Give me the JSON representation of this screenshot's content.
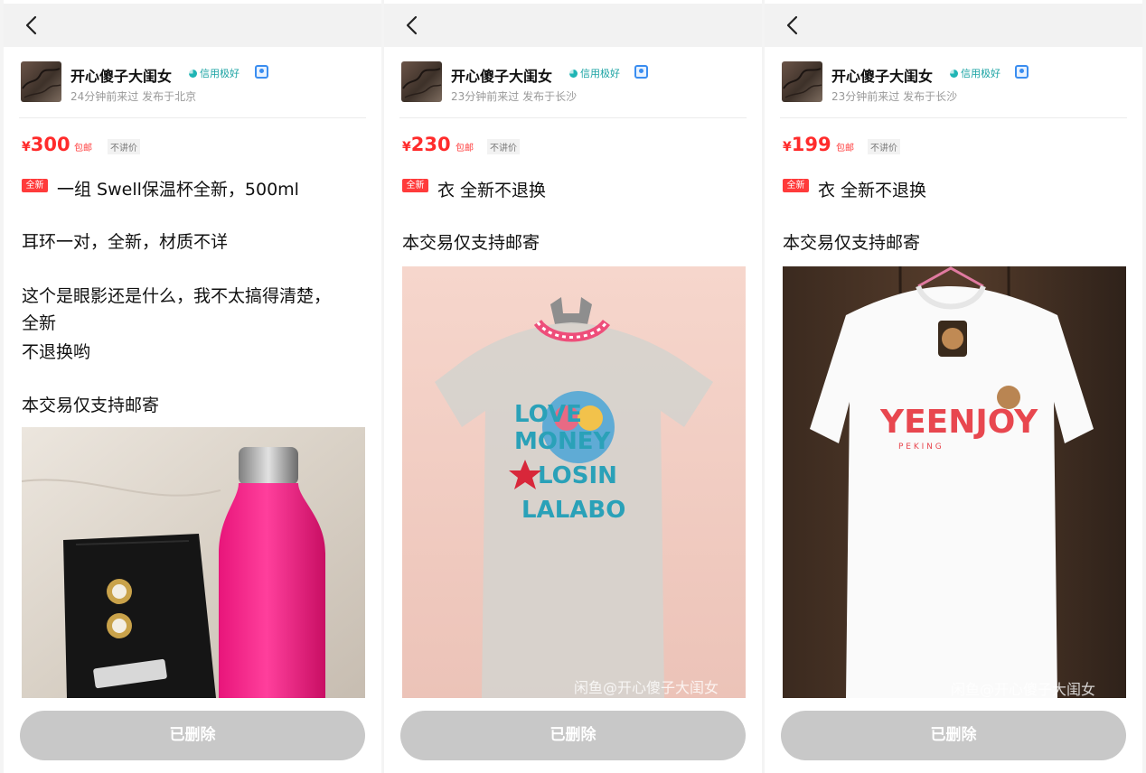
{
  "panels": [
    {
      "back_icon": "chevron-left-icon",
      "username": "开心傻子大闺女",
      "credit": "信用极好",
      "meta": "24分钟前来过 发布于北京",
      "price_symbol": "¥",
      "price": "300",
      "shipping": "包邮",
      "bargain": "不讲价",
      "new_tag": "全新",
      "title": "一组 Swell保温杯全新，500ml",
      "lines": [
        "耳环一对，全新，材质不详",
        "这个是眼影还是什么，我不太搞得清楚，",
        "全新",
        "不退换哟",
        "本交易仅支持邮寄"
      ],
      "button": "已删除"
    },
    {
      "back_icon": "chevron-left-icon",
      "username": "开心傻子大闺女",
      "credit": "信用极好",
      "meta": "23分钟前来过 发布于长沙",
      "price_symbol": "¥",
      "price": "230",
      "shipping": "包邮",
      "bargain": "不讲价",
      "new_tag": "全新",
      "title": "衣 全新不退换",
      "lines": [
        "本交易仅支持邮寄"
      ],
      "shirt_text": [
        "LOVE",
        "MONEY",
        "LOSIN",
        "LALABO"
      ],
      "watermark": "闲鱼@开心傻子大闺女",
      "button": "已删除"
    },
    {
      "back_icon": "chevron-left-icon",
      "username": "开心傻子大闺女",
      "credit": "信用极好",
      "meta": "23分钟前来过 发布于长沙",
      "price_symbol": "¥",
      "price": "199",
      "shipping": "包邮",
      "bargain": "不讲价",
      "new_tag": "全新",
      "title": "衣 全新不退换",
      "lines": [
        "本交易仅支持邮寄"
      ],
      "shirt_text": [
        "YEENJOY",
        "P E K I N G"
      ],
      "watermark": "闲鱼@开心傻子大闺女",
      "button": "已删除"
    }
  ],
  "colors": {
    "price": "#ff2b2b",
    "credit": "#1aa3a3",
    "deleted_button": "#c8c8c8"
  }
}
